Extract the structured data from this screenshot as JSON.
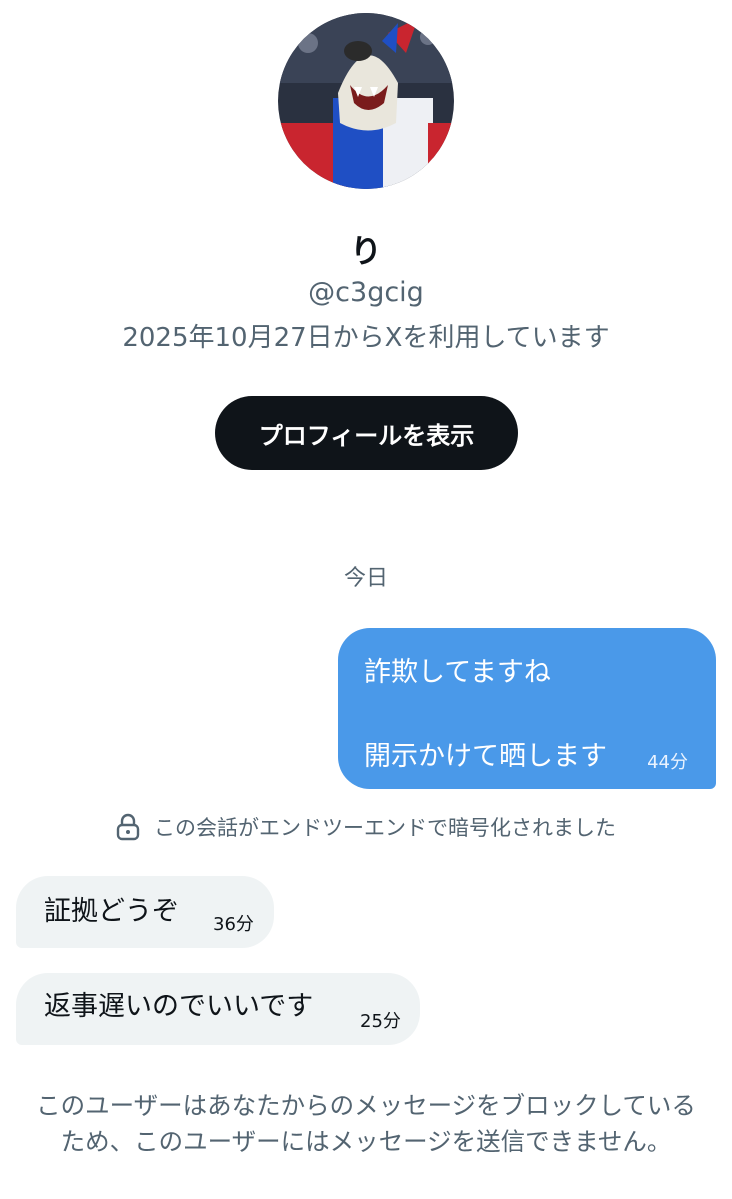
{
  "profile": {
    "display_name": "り",
    "handle": "@c3gcig",
    "joined_text": "2025年10月27日からXを利用しています",
    "view_profile_label": "プロフィールを表示"
  },
  "conversation": {
    "date_separator": "今日",
    "outgoing": {
      "line1": "詐欺してますね",
      "line2": "開示かけて晒します",
      "time": "44分"
    },
    "encryption_notice": "この会話がエンドツーエンドで暗号化されました",
    "incoming": [
      {
        "text": "証拠どうぞ",
        "time": "36分"
      },
      {
        "text": "返事遅いのでいいです",
        "time": "25分"
      }
    ],
    "blocked_notice": "このユーザーはあなたからのメッセージをブロックしているため、このユーザーにはメッセージを送信できません。"
  },
  "colors": {
    "outgoing_bubble": "#4a99e9",
    "incoming_bubble": "#eff3f4",
    "button": "#0f1419",
    "secondary_text": "#536471"
  }
}
